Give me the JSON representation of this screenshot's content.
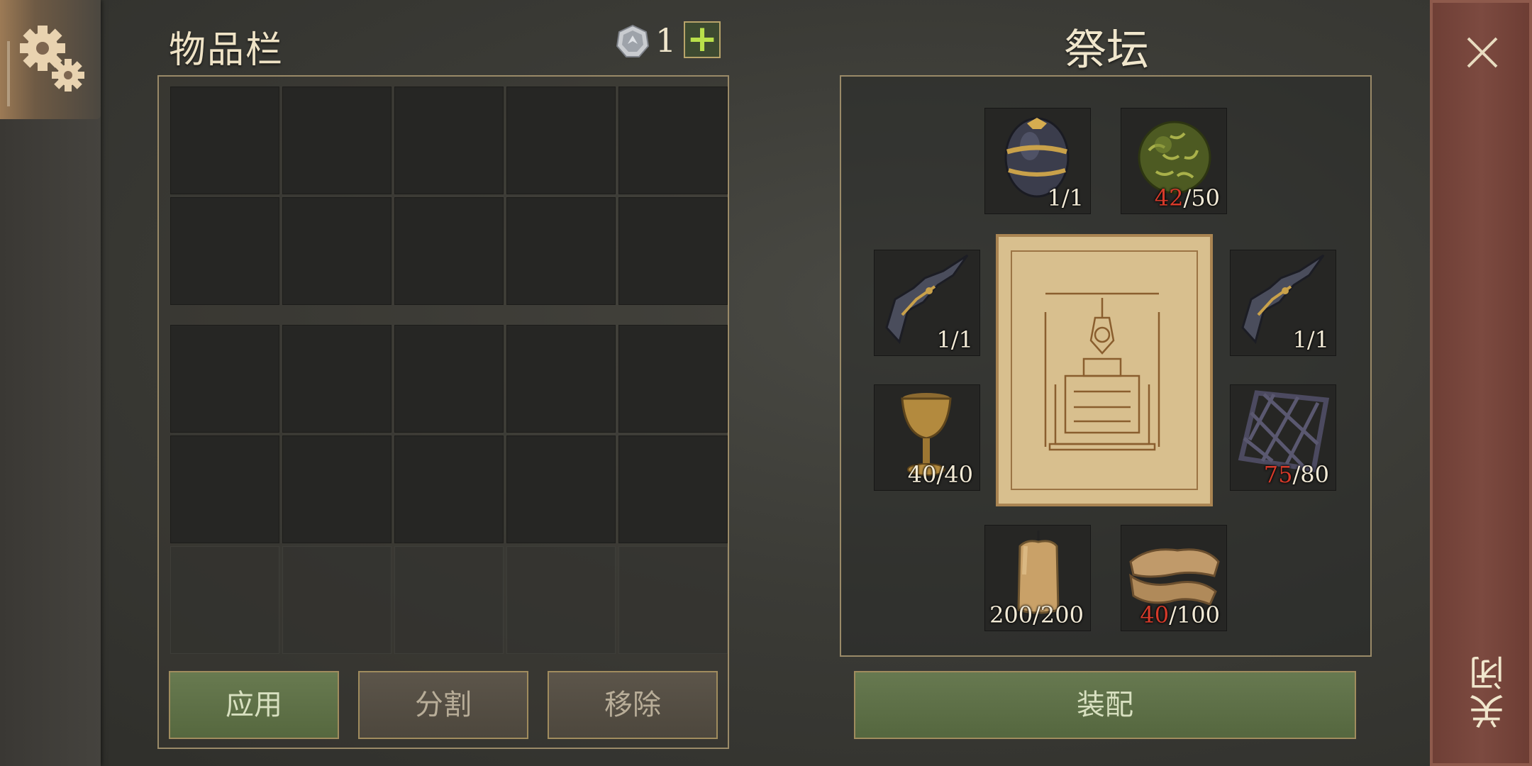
{
  "settings": {
    "icon": "gear-icon"
  },
  "inventory": {
    "title": "物品栏",
    "currency_count": "1",
    "add_label": "+",
    "buttons": {
      "apply": "应用",
      "split": "分割",
      "remove": "移除"
    }
  },
  "altar": {
    "title": "祭坛",
    "equip_label": "装配",
    "slots": [
      {
        "icon": "egg-icon",
        "have": "",
        "need": "1/1"
      },
      {
        "icon": "herb-ball-icon",
        "have": "42",
        "need": "/50"
      },
      {
        "icon": "fang-icon",
        "have": "",
        "need": "1/1"
      },
      {
        "icon": "fang-icon",
        "have": "",
        "need": "1/1"
      },
      {
        "icon": "goblet-icon",
        "have": "",
        "need": "40/40"
      },
      {
        "icon": "grate-icon",
        "have": "75",
        "need": "/80"
      },
      {
        "icon": "candle-icon",
        "have": "",
        "need": "200/200"
      },
      {
        "icon": "cloth-icon",
        "have": "40",
        "need": "/100"
      }
    ]
  },
  "close": {
    "label": "关闭"
  },
  "colors": {
    "accent_green": "#687a50",
    "deficit_red": "#d63a2a",
    "close_strip": "#7c4a40"
  }
}
